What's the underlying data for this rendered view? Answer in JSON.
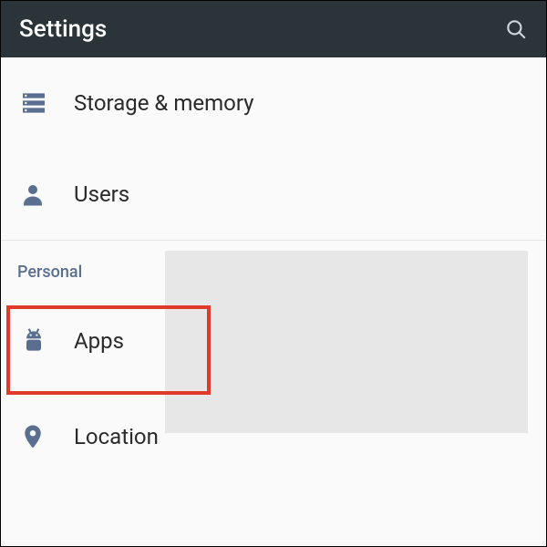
{
  "header": {
    "title": "Settings"
  },
  "items": {
    "storage": "Storage & memory",
    "users": "Users",
    "apps": "Apps",
    "location": "Location"
  },
  "sections": {
    "personal": "Personal"
  }
}
